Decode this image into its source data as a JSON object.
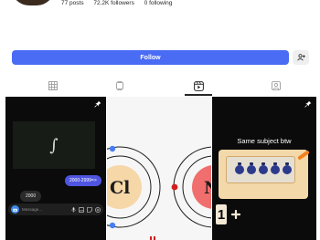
{
  "profile": {
    "posts": "77 posts",
    "followers": "72.2K followers",
    "following": "0 following"
  },
  "actions": {
    "follow_label": "Follow"
  },
  "tabs": [
    {
      "icon": "grid-icon",
      "active": false
    },
    {
      "icon": "feed-icon",
      "active": false
    },
    {
      "icon": "reels-icon",
      "active": true
    },
    {
      "icon": "tagged-icon",
      "active": false
    }
  ],
  "posts": [
    {
      "pinned": true,
      "panel_symbol": "∫",
      "outgoing_message": "2000-2999=>",
      "incoming_message": "2000",
      "composer_placeholder": "Message..."
    },
    {
      "pinned": false,
      "atom_left_symbol": "Cl",
      "atom_right_symbol": "N"
    },
    {
      "pinned": true,
      "caption": "Same subject btw",
      "visible_digit": "1"
    }
  ],
  "colors": {
    "follow": "#4a6bf3",
    "accent_chat": "#4f55e0",
    "atom_left": "#f5d7a8",
    "atom_right": "#f06e6e",
    "electron_blue": "#4a7df0",
    "electron_red": "#d11f1f"
  }
}
